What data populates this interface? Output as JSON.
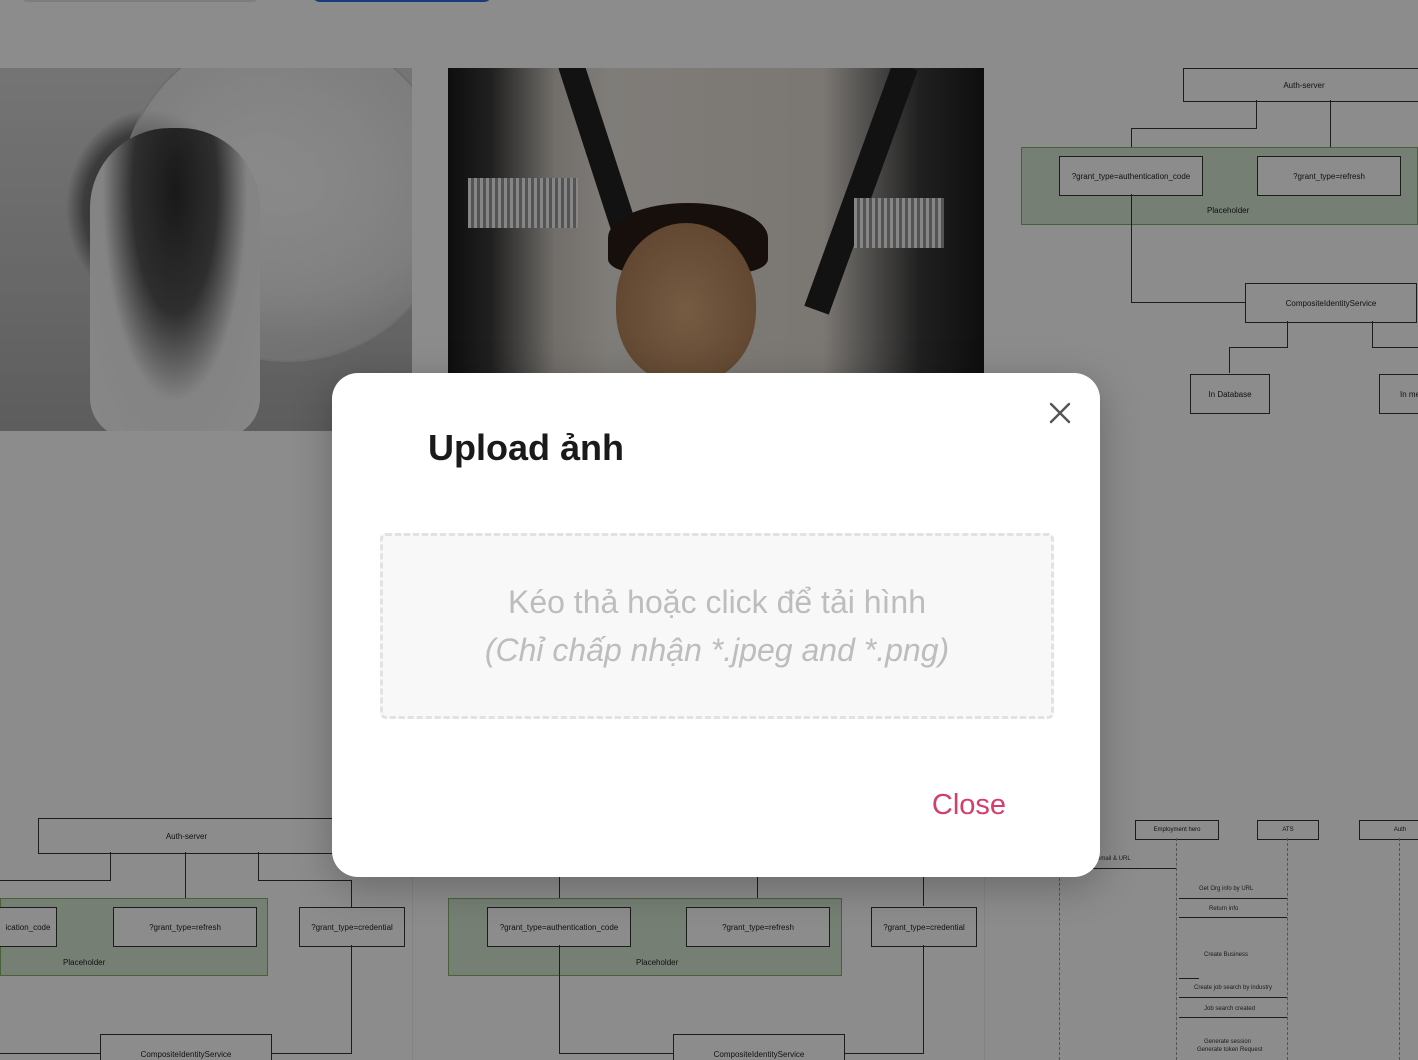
{
  "modal": {
    "title": "Upload ảnh",
    "dropzone_line1": "Kéo thả hoặc click để tải hình",
    "dropzone_line2": "(Chỉ chấp nhận *.jpeg and *.png)",
    "close_label": "Close",
    "close_icon": "close-icon"
  },
  "gallery": {
    "diagram_a": {
      "auth_server": "Auth-server",
      "grant_auth_code": "?grant_type=authentication_code",
      "grant_refresh": "?grant_type=refresh",
      "placeholder": "Placeholder",
      "composite": "CompositeIdentityService",
      "in_database": "In Database",
      "in_memory": "In me"
    },
    "diagram_b": {
      "auth_server": "Auth-server",
      "grant_auth_code": "ication_code",
      "grant_refresh": "?grant_type=refresh",
      "grant_credential": "?grant_type=credential",
      "placeholder": "Placeholder",
      "composite": "CompositeIdentityService"
    },
    "diagram_c": {
      "grant_auth_code": "?grant_type=authentication_code",
      "grant_refresh": "?grant_type=refresh",
      "grant_credential": "?grant_type=credential",
      "placeholder": "Placeholder",
      "composite": "CompositeIdentityService"
    },
    "diagram_d": {
      "employment_hero": "Employment hero",
      "ats": "ATS",
      "auth": "Auth",
      "msg1": "email & URL",
      "msg2": "Get Org info by URL",
      "msg3": "Return info",
      "msg4": "Create Business",
      "msg5": "Create job search by industry",
      "msg6": "Job search created",
      "msg7": "Generate session",
      "msg8": "Generate token Request"
    }
  },
  "colors": {
    "accent_close": "#d63d6a",
    "group_fill": "#d5e8d4",
    "top_button": "#2f6be0"
  }
}
